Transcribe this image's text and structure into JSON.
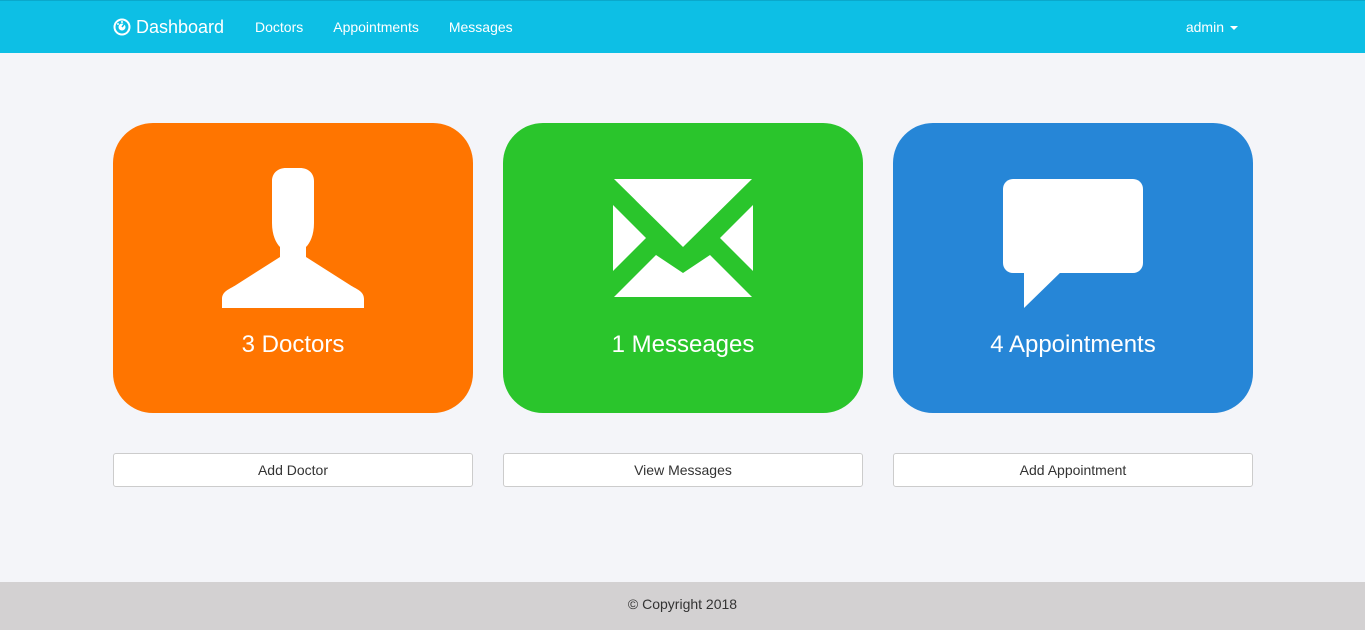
{
  "nav": {
    "brand": "Dashboard",
    "brand_icon": "dashboard-gauge-icon",
    "links": [
      "Doctors",
      "Appointments",
      "Messages"
    ],
    "user": "admin",
    "background": "#0dbfe5"
  },
  "cards": [
    {
      "label": "3 Doctors",
      "icon": "user-icon",
      "color": "#ff7500",
      "button": "Add Doctor"
    },
    {
      "label": "1 Messeages",
      "icon": "envelope-icon",
      "color": "#2ac52c",
      "button": "View Messages"
    },
    {
      "label": "4 Appointments",
      "icon": "comment-icon",
      "color": "#2686d7",
      "button": "Add Appointment"
    }
  ],
  "footer": {
    "text": "© Copyright 2018"
  }
}
